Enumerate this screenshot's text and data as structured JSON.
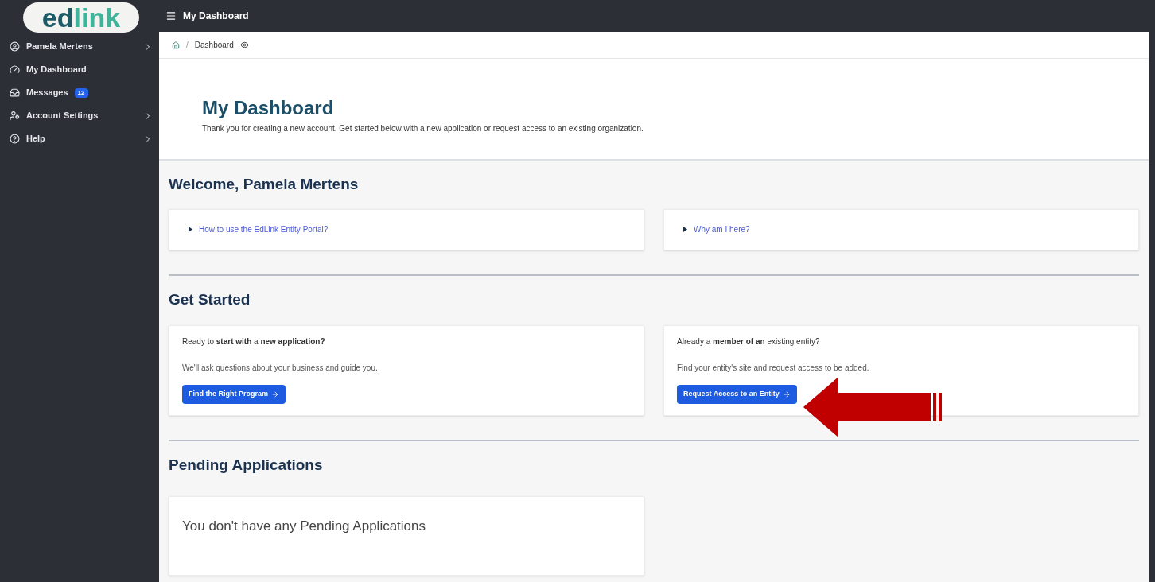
{
  "logo": {
    "part_1": "ed",
    "part_2": "link"
  },
  "topbar": {
    "title": "My Dashboard"
  },
  "sidebar": {
    "items": [
      {
        "kind": "user",
        "label": "Pamela Mertens",
        "expandable": true
      },
      {
        "kind": "dashboard",
        "label": "My Dashboard",
        "expandable": false
      },
      {
        "kind": "messages",
        "label": "Messages",
        "badge": "12",
        "expandable": false
      },
      {
        "kind": "account",
        "label": "Account Settings",
        "expandable": true
      },
      {
        "kind": "help",
        "label": "Help",
        "expandable": true
      }
    ]
  },
  "breadcrumb": {
    "separator": "/",
    "current": "Dashboard"
  },
  "header": {
    "title": "My Dashboard",
    "subtitle": "Thank you for creating a new account. Get started below with a new application or request access to an existing organization."
  },
  "welcome": {
    "title": "Welcome, Pamela Mertens",
    "links": [
      "How to use the EdLink Entity Portal?",
      "Why am I here?"
    ]
  },
  "get_started": {
    "title": "Get Started",
    "cards": [
      {
        "question": "Ready to **start with** a **new application?**",
        "text": "We'll ask questions about your business and guide you.",
        "button": "Find the Right Program"
      },
      {
        "question": "Already a **member of an** existing entity?",
        "text": "Find your entity's site and request access to be added.",
        "button": "Request Access to an Entity"
      }
    ]
  },
  "pending": {
    "title": "Pending Applications",
    "empty": "You don't have any Pending Applications"
  }
}
